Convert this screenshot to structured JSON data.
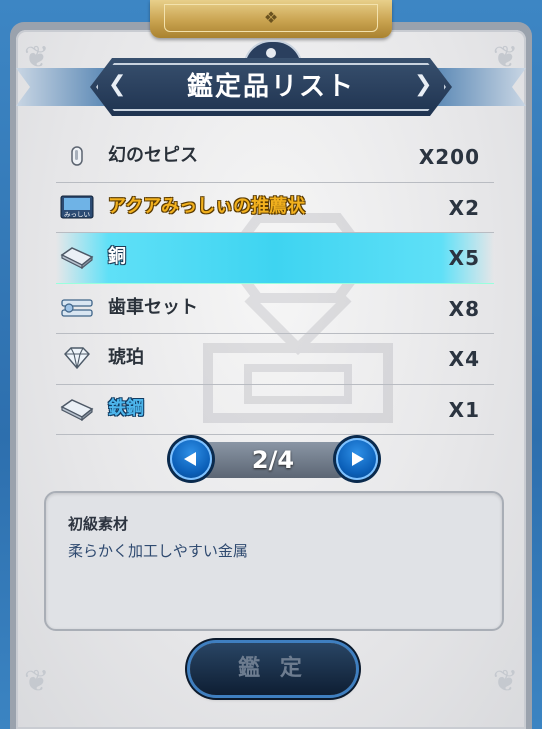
{
  "header": {
    "title": "鑑定品リスト"
  },
  "items": [
    {
      "name": "幻のセピス",
      "quantity": "X200",
      "icon": "sepith-drop-icon",
      "style": "dark",
      "selected": false
    },
    {
      "name": "アクアみっしぃの推薦状",
      "icon_label": "みっしい",
      "quantity": "X2",
      "icon": "letter-card-icon",
      "style": "gold",
      "selected": false
    },
    {
      "name": "銅",
      "quantity": "X5",
      "icon": "metal-ingot-icon",
      "style": "light",
      "selected": true
    },
    {
      "name": "歯車セット",
      "quantity": "X8",
      "icon": "gear-set-icon",
      "style": "dark",
      "selected": false
    },
    {
      "name": "琥珀",
      "quantity": "X4",
      "icon": "gem-icon",
      "style": "dark",
      "selected": false
    },
    {
      "name": "鉄鋼",
      "quantity": "X1",
      "icon": "metal-ingot-icon",
      "style": "blue",
      "selected": false
    }
  ],
  "pager": {
    "label": "2/4"
  },
  "description": {
    "category": "初級素材",
    "text": "柔らかく加工しやすい金属"
  },
  "actions": {
    "appraise_label": "鑑 定"
  },
  "colors": {
    "selected_row": "#3ed4f1",
    "gold_text": "#f2b11e",
    "blue_text": "#4db6ec",
    "panel_frame": "#2d6fae"
  }
}
